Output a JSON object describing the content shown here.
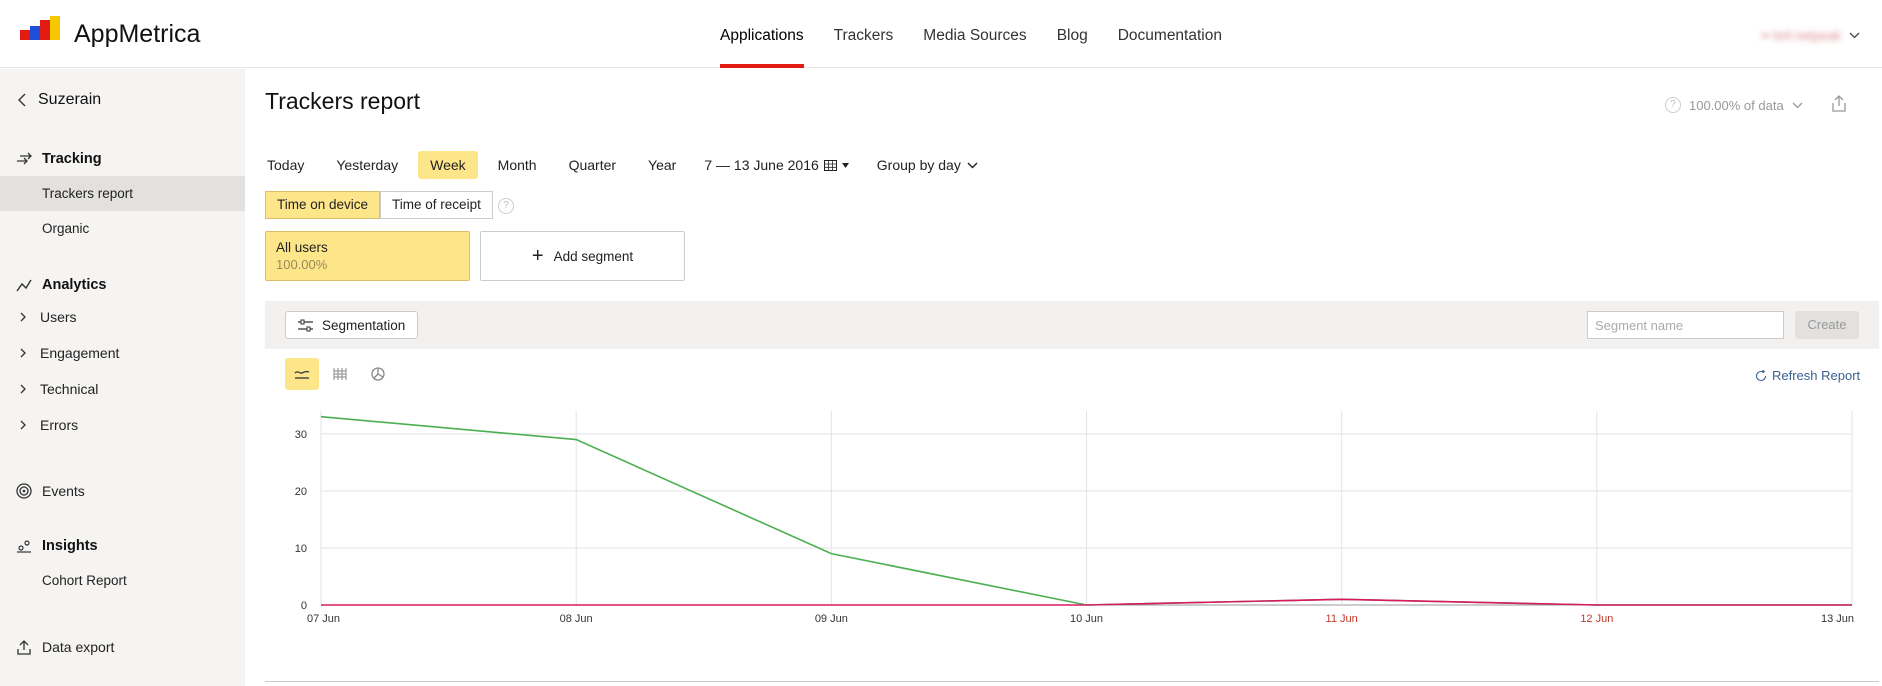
{
  "header": {
    "app_name": "AppMetrica",
    "nav": [
      "Applications",
      "Trackers",
      "Media Sources",
      "Blog",
      "Documentation"
    ],
    "active_nav": "Applications",
    "user_name": "•• bril netpeak"
  },
  "sidebar": {
    "back_label": "Suzerain",
    "tracking": {
      "title": "Tracking",
      "items": [
        "Trackers report",
        "Organic"
      ]
    },
    "analytics": {
      "title": "Analytics",
      "items": [
        "Users",
        "Engagement",
        "Technical",
        "Errors"
      ]
    },
    "events_label": "Events",
    "insights": {
      "title": "Insights",
      "items": [
        "Cohort Report"
      ]
    },
    "data_export_label": "Data export"
  },
  "page": {
    "title": "Trackers report",
    "data_sample": "100.00% of data",
    "periods": [
      "Today",
      "Yesterday",
      "Week",
      "Month",
      "Quarter",
      "Year"
    ],
    "selected_period": "Week",
    "date_range": "7 — 13 June 2016",
    "group_by": "Group by day",
    "time_modes": [
      "Time on device",
      "Time of receipt"
    ],
    "selected_time_mode": "Time on device",
    "help_mark": "?",
    "segments": [
      {
        "name": "All users",
        "value": "100.00%"
      }
    ],
    "add_segment_label": "Add segment",
    "segmentation_label": "Segmentation",
    "segment_name_placeholder": "Segment name",
    "create_label": "Create",
    "refresh_label": "Refresh Report"
  },
  "colors": {
    "accent": "#fde58a",
    "nav_active": "#e41b13",
    "series_green": "#4caf50",
    "series_red": "#d81b60",
    "weekend_label": "#c0392b"
  },
  "chart_data": {
    "type": "line",
    "x": [
      "07 Jun",
      "08 Jun",
      "09 Jun",
      "10 Jun",
      "11 Jun",
      "12 Jun",
      "13 Jun"
    ],
    "weekend_labels": [
      "11 Jun",
      "12 Jun"
    ],
    "yticks": [
      0,
      10,
      20,
      30
    ],
    "ylim": [
      0,
      34
    ],
    "grid": true,
    "series": [
      {
        "color": "#4caf50",
        "values": [
          33,
          29,
          9,
          0,
          1,
          0,
          0
        ]
      },
      {
        "color": "#d81b60",
        "values": [
          0,
          0,
          0,
          0,
          1,
          0,
          0
        ]
      }
    ]
  }
}
